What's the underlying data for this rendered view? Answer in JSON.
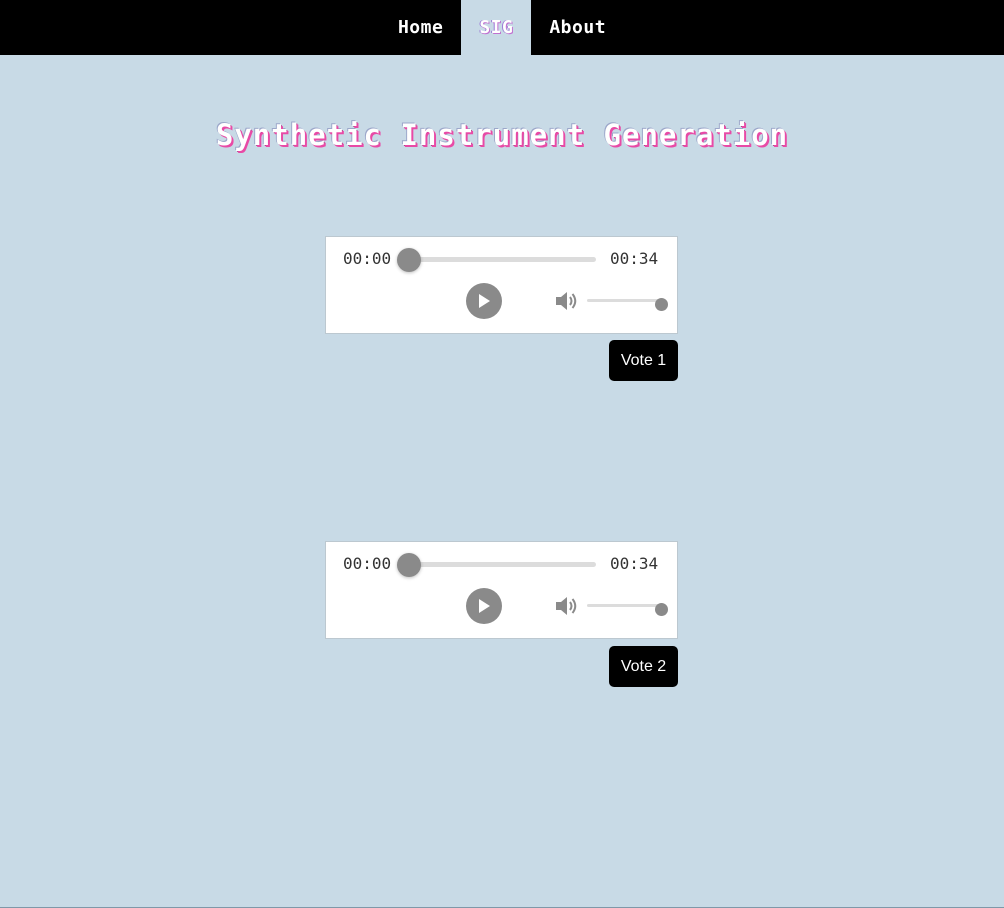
{
  "nav": {
    "items": [
      {
        "label": "Home",
        "active": false
      },
      {
        "label": "SIG",
        "active": true
      },
      {
        "label": "About",
        "active": false
      }
    ]
  },
  "page": {
    "title": "Synthetic Instrument Generation"
  },
  "players": [
    {
      "current_time": "00:00",
      "duration": "00:34",
      "progress": 0,
      "volume": 1.0,
      "vote_label": "Vote 1"
    },
    {
      "current_time": "00:00",
      "duration": "00:34",
      "progress": 0,
      "volume": 1.0,
      "vote_label": "Vote 2"
    }
  ],
  "colors": {
    "background": "#c8dae6",
    "nav_bg": "#000000",
    "accent": "#e84aa6",
    "control_grey": "#8a8a8a"
  },
  "icons": {
    "play": "play-icon",
    "volume": "volume-icon"
  }
}
